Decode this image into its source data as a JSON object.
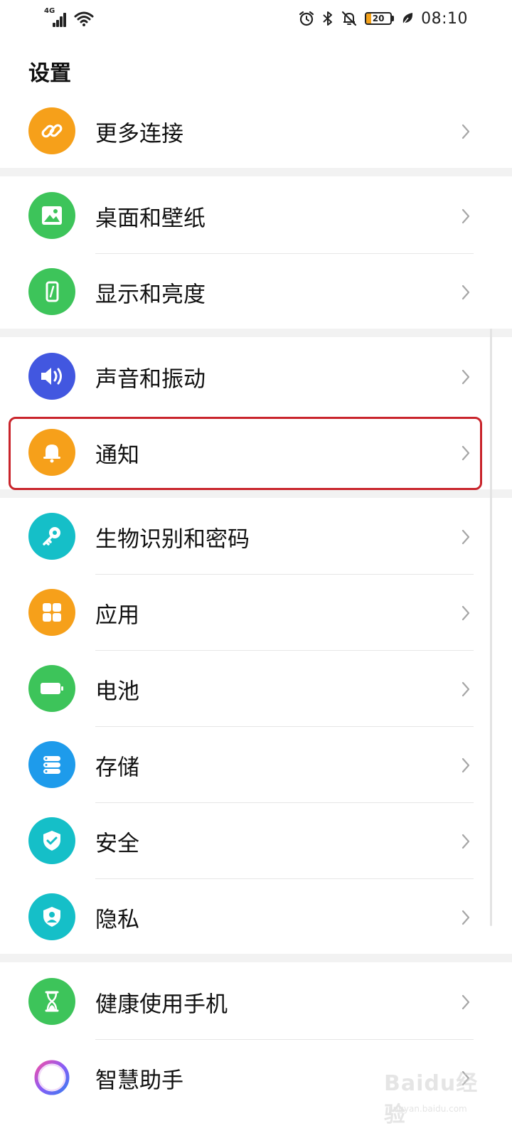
{
  "status_bar": {
    "network": "4G",
    "battery_level": "20",
    "time": "08:10",
    "icons": [
      "signal-icon",
      "wifi-icon",
      "alarm-icon",
      "bluetooth-icon",
      "mute-bell-icon",
      "battery-icon",
      "power-saving-leaf-icon"
    ]
  },
  "page_title": "设置",
  "groups": [
    {
      "items": [
        {
          "label": "更多连接",
          "icon": "link-icon",
          "color": "#F6A01A"
        }
      ]
    },
    {
      "items": [
        {
          "label": "桌面和壁纸",
          "icon": "image-icon",
          "color": "#3DC45A"
        },
        {
          "label": "显示和亮度",
          "icon": "phone-brightness-icon",
          "color": "#3DC45A"
        }
      ]
    },
    {
      "items": [
        {
          "label": "声音和振动",
          "icon": "speaker-icon",
          "color": "#4257E0"
        },
        {
          "label": "通知",
          "icon": "bell-icon",
          "color": "#F6A01A",
          "highlighted": true
        }
      ]
    },
    {
      "items": [
        {
          "label": "生物识别和密码",
          "icon": "key-icon",
          "color": "#15BFC8"
        },
        {
          "label": "应用",
          "icon": "apps-grid-icon",
          "color": "#F6A01A"
        },
        {
          "label": "电池",
          "icon": "battery-icon",
          "color": "#3DC45A"
        },
        {
          "label": "存储",
          "icon": "storage-icon",
          "color": "#1E9BEB"
        },
        {
          "label": "安全",
          "icon": "shield-check-icon",
          "color": "#15BFC8"
        },
        {
          "label": "隐私",
          "icon": "privacy-icon",
          "color": "#15BFC8"
        }
      ]
    },
    {
      "items": [
        {
          "label": "健康使用手机",
          "icon": "hourglass-icon",
          "color": "#3DC45A"
        },
        {
          "label": "智慧助手",
          "icon": "assistant-ring-icon",
          "color": "#8A5CF6"
        }
      ]
    }
  ],
  "watermark": {
    "main": "Baidu经验",
    "sub": "jingyan.baidu.com"
  }
}
